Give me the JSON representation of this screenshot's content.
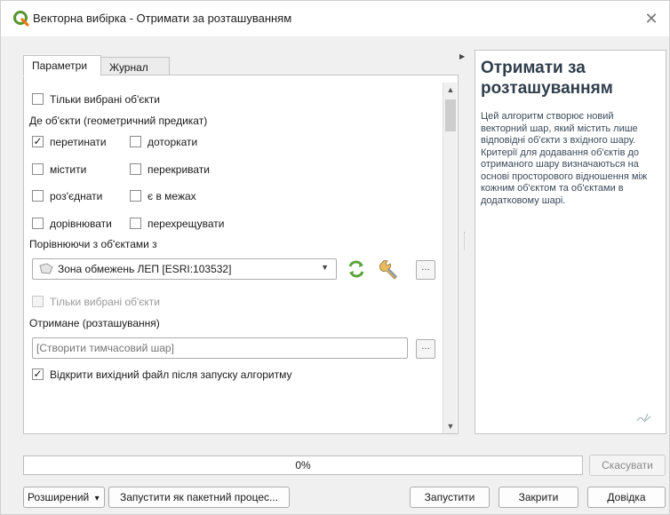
{
  "window": {
    "title": "Векторна вибірка - Отримати за розташуванням",
    "close_glyph": "✕"
  },
  "tabs": [
    {
      "label": "Параметри",
      "active": true
    },
    {
      "label": "Журнал",
      "active": false
    }
  ],
  "params": {
    "selected_only_1": {
      "label": "Тільки вибрані об'єкти",
      "checked": false
    },
    "predicate_label": "Де об'єкти (геометричний предикат)",
    "predicates": [
      {
        "label": "перетинати",
        "checked": true
      },
      {
        "label": "доторкати",
        "checked": false
      },
      {
        "label": "містити",
        "checked": false
      },
      {
        "label": "перекривати",
        "checked": false
      },
      {
        "label": "роз'єднати",
        "checked": false
      },
      {
        "label": "є в межах",
        "checked": false
      },
      {
        "label": "дорівнювати",
        "checked": false
      },
      {
        "label": "перехрещувати",
        "checked": false
      }
    ],
    "compare_label": "Порівнюючи з об'єктами з",
    "compare_layer": "Зона обмежень ЛЕП [ESRI:103532]",
    "selected_only_2": {
      "label": "Тільки вибрані об'єкти",
      "checked": false,
      "disabled": true
    },
    "output_label": "Отримане (розташування)",
    "output_placeholder": "[Створити тимчасовий шар]",
    "open_output": {
      "label": "Відкрити вихідний файл після запуску алгоритму",
      "checked": true
    },
    "dots": "…"
  },
  "help": {
    "title": "Отримати за розташуванням",
    "body": "Цей алгоритм створює новий векторний шар, який містить лише відповідні об'єкти з вхідного шару. Критерії для додавання об'єктів до отриманого шару визначаються на основі просторового відношення між кожним об'єктом та об'єктами в додатковому шарі."
  },
  "progress": {
    "value": 0,
    "label": "0%"
  },
  "buttons": {
    "cancel": "Скасувати",
    "advanced": "Розширений",
    "advanced_arrow": "▾",
    "batch": "Запустити як пакетний процес...",
    "run": "Запустити",
    "close": "Закрити",
    "help": "Довідка"
  },
  "colors": {
    "accent_green": "#4caf50",
    "help_title": "#303e4c",
    "progress_fill": "#06b025"
  }
}
